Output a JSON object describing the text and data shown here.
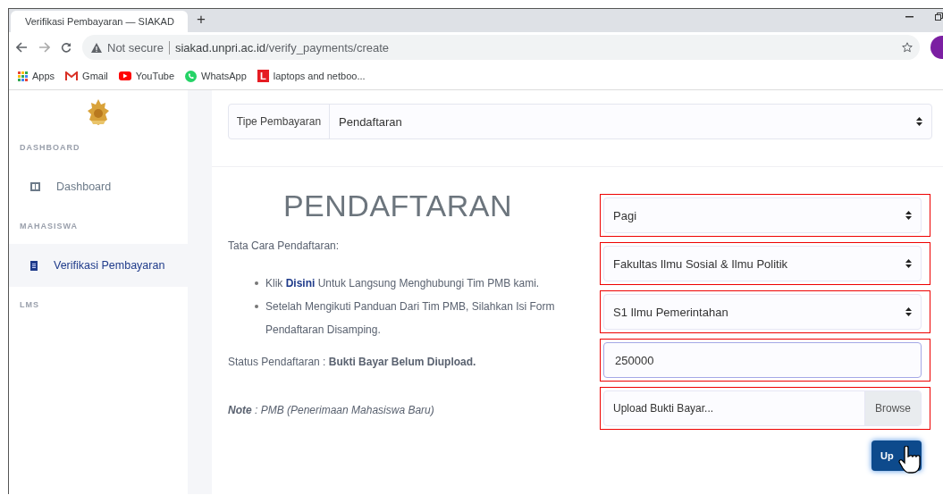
{
  "browser": {
    "tab_title": "Verifikasi Pembayaran — SIAKAD",
    "new_tab": "+",
    "security": "Not secure",
    "url_host": "siakad.unpri.ac.id",
    "url_path": "/verify_payments/create",
    "bookmarks": [
      {
        "label": "Apps",
        "kind": "apps"
      },
      {
        "label": "Gmail",
        "kind": "gmail"
      },
      {
        "label": "YouTube",
        "kind": "youtube"
      },
      {
        "label": "WhatsApp",
        "kind": "whatsapp"
      },
      {
        "label": "laptops and netboo...",
        "kind": "letter",
        "badge": "L"
      }
    ]
  },
  "sidebar": {
    "sections": [
      {
        "heading": "DASHBOARD",
        "items": [
          {
            "label": "Dashboard",
            "kind": "columns",
            "selected": false
          }
        ]
      },
      {
        "heading": "MAHASISWA",
        "items": [
          {
            "label": "Verifikasi Pembayaran",
            "kind": "receipt",
            "selected": true
          }
        ]
      },
      {
        "heading": "LMS"
      }
    ]
  },
  "payment_type": {
    "label": "Tipe Pembayaran",
    "value": "Pendaftaran"
  },
  "info": {
    "title": "PENDAFTARAN",
    "intro": "Tata Cara Pendaftaran:",
    "steps": [
      {
        "before": "Klik ",
        "link": "Disini",
        "after": " Untuk Langsung Menghubungi Tim PMB kami."
      },
      {
        "before": "Setelah Mengikuti Panduan Dari Tim PMB, Silahkan Isi Form Pendaftaran Disamping."
      }
    ],
    "status": "Status Pendaftaran : **Bukti Bayar Belum Diupload.**",
    "note": "**Note** : PMB (Penerimaan Mahasiswa Baru)"
  },
  "form": {
    "fields": [
      {
        "kind": "select",
        "value": "Pagi",
        "highlighted": true
      },
      {
        "kind": "select",
        "value": "Fakultas Ilmu Sosial & Ilmu Politik",
        "highlighted": true
      },
      {
        "kind": "select",
        "value": "S1 Ilmu Pemerintahan",
        "highlighted": true
      },
      {
        "kind": "input",
        "value": "250000",
        "highlighted": true
      },
      {
        "kind": "file",
        "placeholder": "Upload Bukti Bayar...",
        "button": "Browse",
        "highlighted": true
      }
    ],
    "submit": "Up"
  }
}
